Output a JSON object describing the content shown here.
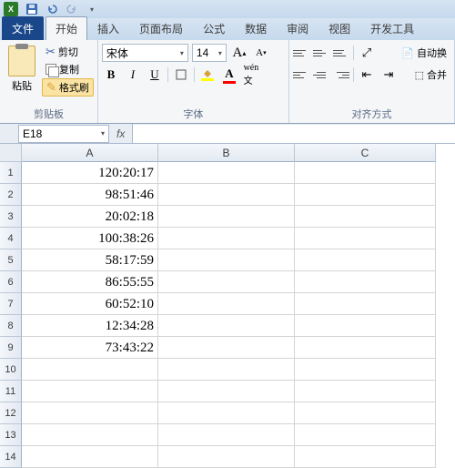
{
  "qat": {
    "save": "save-icon",
    "undo": "undo-icon",
    "redo": "redo-icon"
  },
  "tabs": {
    "file": "文件",
    "items": [
      "开始",
      "插入",
      "页面布局",
      "公式",
      "数据",
      "审阅",
      "视图",
      "开发工具"
    ],
    "active": 0
  },
  "ribbon": {
    "clipboard": {
      "paste": "粘贴",
      "cut": "剪切",
      "copy": "复制",
      "format_painter": "格式刷",
      "label": "剪贴板"
    },
    "font": {
      "name": "宋体",
      "size": "14",
      "grow": "A",
      "shrink": "A",
      "bold": "B",
      "italic": "I",
      "underline": "U",
      "label": "字体",
      "fill_color": "#ffff00",
      "font_color": "#ff0000"
    },
    "align": {
      "label": "对齐方式",
      "wrap": "自动换",
      "merge": "合并"
    }
  },
  "name_box": "E18",
  "fx_label": "fx",
  "formula": "",
  "columns": [
    "A",
    "B",
    "C"
  ],
  "row_count": 14,
  "cells": {
    "A": [
      "120:20:17",
      "98:51:46",
      "20:02:18",
      "100:38:26",
      "58:17:59",
      "86:55:55",
      "60:52:10",
      "12:34:28",
      "73:43:22",
      "",
      "",
      "",
      "",
      ""
    ]
  }
}
